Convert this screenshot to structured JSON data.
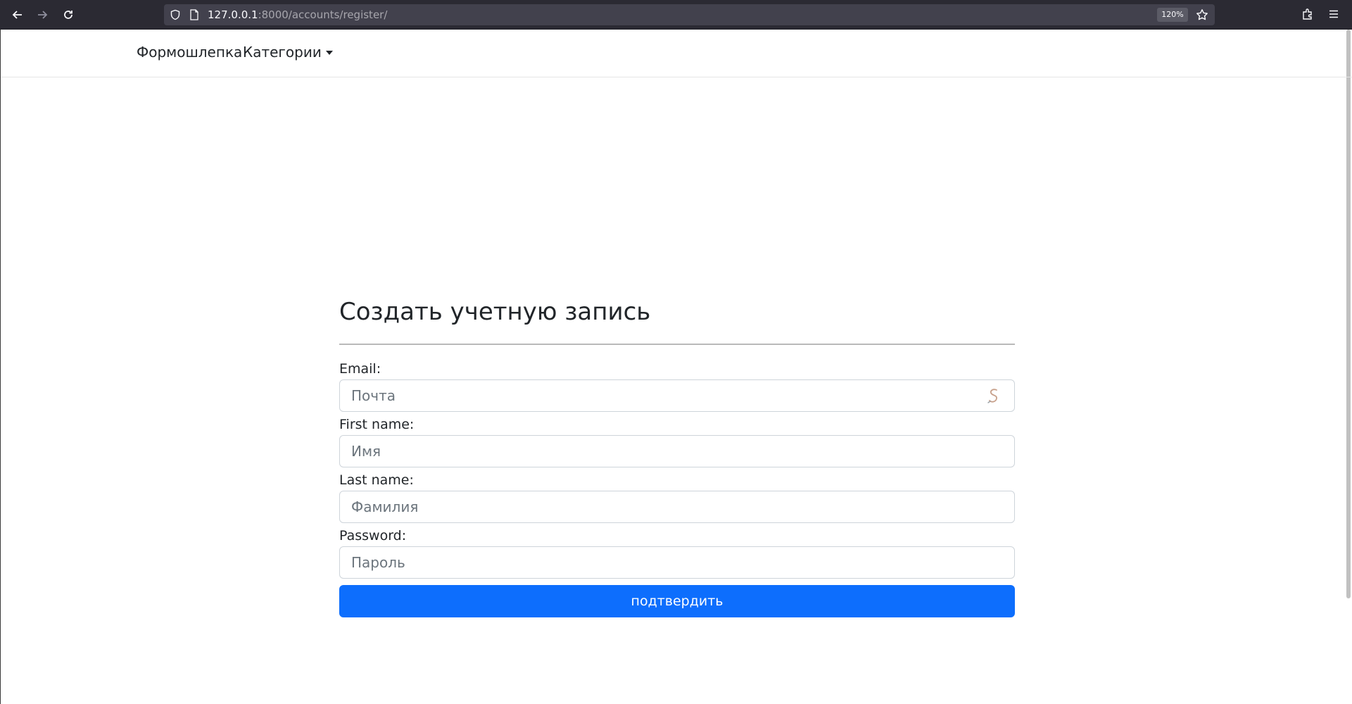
{
  "browser": {
    "url_host": "127.0.0.1",
    "url_path": ":8000/accounts/register/",
    "zoom": "120%",
    "icons": [
      "back-arrow-icon",
      "forward-arrow-icon",
      "reload-icon",
      "shield-icon",
      "page-icon",
      "bookmark-star-icon",
      "extensions-icon",
      "menu-icon"
    ]
  },
  "navbar": {
    "brand": "Формошлепка",
    "dropdown_label": "Категории"
  },
  "form": {
    "title": "Создать учетную запись",
    "fields": [
      {
        "label": "Email:",
        "placeholder": "Почта"
      },
      {
        "label": "First name:",
        "placeholder": "Имя"
      },
      {
        "label": "Last name:",
        "placeholder": "Фамилия"
      },
      {
        "label": "Password:",
        "placeholder": "Пароль"
      }
    ],
    "submit_label": "подтвердить",
    "accent_color": "#0d6efd"
  }
}
